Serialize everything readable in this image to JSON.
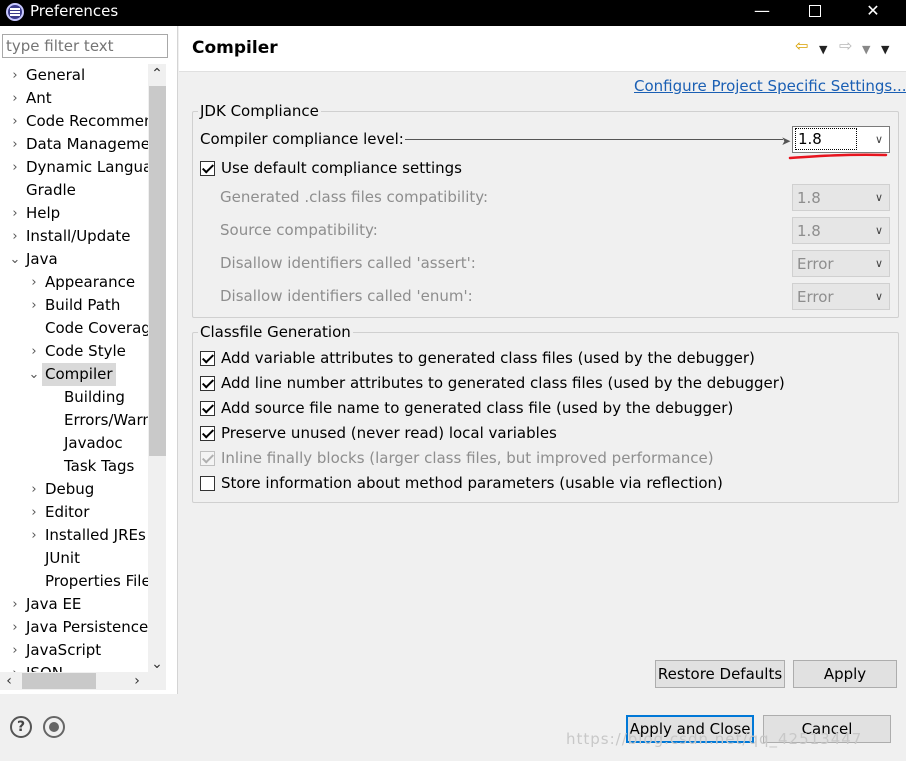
{
  "window": {
    "title": "Preferences",
    "minimize": "—",
    "close": "✕"
  },
  "sidebar": {
    "filter_placeholder": "type filter text",
    "items": [
      {
        "label": "General",
        "level": 0,
        "expand": "collapsed"
      },
      {
        "label": "Ant",
        "level": 0,
        "expand": "collapsed"
      },
      {
        "label": "Code Recommenders",
        "level": 0,
        "expand": "collapsed"
      },
      {
        "label": "Data Management",
        "level": 0,
        "expand": "collapsed"
      },
      {
        "label": "Dynamic Languages",
        "level": 0,
        "expand": "collapsed"
      },
      {
        "label": "Gradle",
        "level": 0,
        "expand": "none"
      },
      {
        "label": "Help",
        "level": 0,
        "expand": "collapsed"
      },
      {
        "label": "Install/Update",
        "level": 0,
        "expand": "collapsed"
      },
      {
        "label": "Java",
        "level": 0,
        "expand": "expanded"
      },
      {
        "label": "Appearance",
        "level": 1,
        "expand": "collapsed"
      },
      {
        "label": "Build Path",
        "level": 1,
        "expand": "collapsed"
      },
      {
        "label": "Code Coverage",
        "level": 1,
        "expand": "none"
      },
      {
        "label": "Code Style",
        "level": 1,
        "expand": "collapsed"
      },
      {
        "label": "Compiler",
        "level": 1,
        "expand": "expanded",
        "selected": true
      },
      {
        "label": "Building",
        "level": 2,
        "expand": "none"
      },
      {
        "label": "Errors/Warnings",
        "level": 2,
        "expand": "none"
      },
      {
        "label": "Javadoc",
        "level": 2,
        "expand": "none"
      },
      {
        "label": "Task Tags",
        "level": 2,
        "expand": "none"
      },
      {
        "label": "Debug",
        "level": 1,
        "expand": "collapsed"
      },
      {
        "label": "Editor",
        "level": 1,
        "expand": "collapsed"
      },
      {
        "label": "Installed JREs",
        "level": 1,
        "expand": "collapsed"
      },
      {
        "label": "JUnit",
        "level": 1,
        "expand": "none"
      },
      {
        "label": "Properties Files Editor",
        "level": 1,
        "expand": "none"
      },
      {
        "label": "Java EE",
        "level": 0,
        "expand": "collapsed"
      },
      {
        "label": "Java Persistence",
        "level": 0,
        "expand": "collapsed"
      },
      {
        "label": "JavaScript",
        "level": 0,
        "expand": "collapsed"
      },
      {
        "label": "JSON",
        "level": 0,
        "expand": "collapsed"
      }
    ]
  },
  "page": {
    "title": "Compiler",
    "configure_link": "Configure Project Specific Settings...",
    "jdk": {
      "legend": "JDK Compliance",
      "compliance_label": "Compiler compliance level:",
      "compliance_value": "1.8",
      "use_default_label": "Use default compliance settings",
      "use_default_checked": true,
      "settings": [
        {
          "label": "Generated .class files compatibility:",
          "value": "1.8"
        },
        {
          "label": "Source compatibility:",
          "value": "1.8"
        },
        {
          "label": "Disallow identifiers called 'assert':",
          "value": "Error"
        },
        {
          "label": "Disallow identifiers called 'enum':",
          "value": "Error"
        }
      ]
    },
    "classfile": {
      "legend": "Classfile Generation",
      "options": [
        {
          "label": "Add variable attributes to generated class files (used by the debugger)",
          "checked": true,
          "enabled": true
        },
        {
          "label": "Add line number attributes to generated class files (used by the debugger)",
          "checked": true,
          "enabled": true
        },
        {
          "label": "Add source file name to generated class file (used by the debugger)",
          "checked": true,
          "enabled": true
        },
        {
          "label": "Preserve unused (never read) local variables",
          "checked": true,
          "enabled": true
        },
        {
          "label": "Inline finally blocks (larger class files, but improved performance)",
          "checked": true,
          "enabled": false
        },
        {
          "label": "Store information about method parameters (usable via reflection)",
          "checked": false,
          "enabled": true
        }
      ]
    },
    "restore_defaults": "Restore Defaults",
    "apply": "Apply"
  },
  "footer": {
    "help_icon": "?",
    "apply_and_close": "Apply and Close",
    "cancel": "Cancel",
    "watermark": "https://blog.csdn.net/qq_42513447"
  },
  "colors": {
    "link": "#1a5fb4",
    "annotation_red": "#e8141e",
    "default_button_border": "#0078d7"
  }
}
